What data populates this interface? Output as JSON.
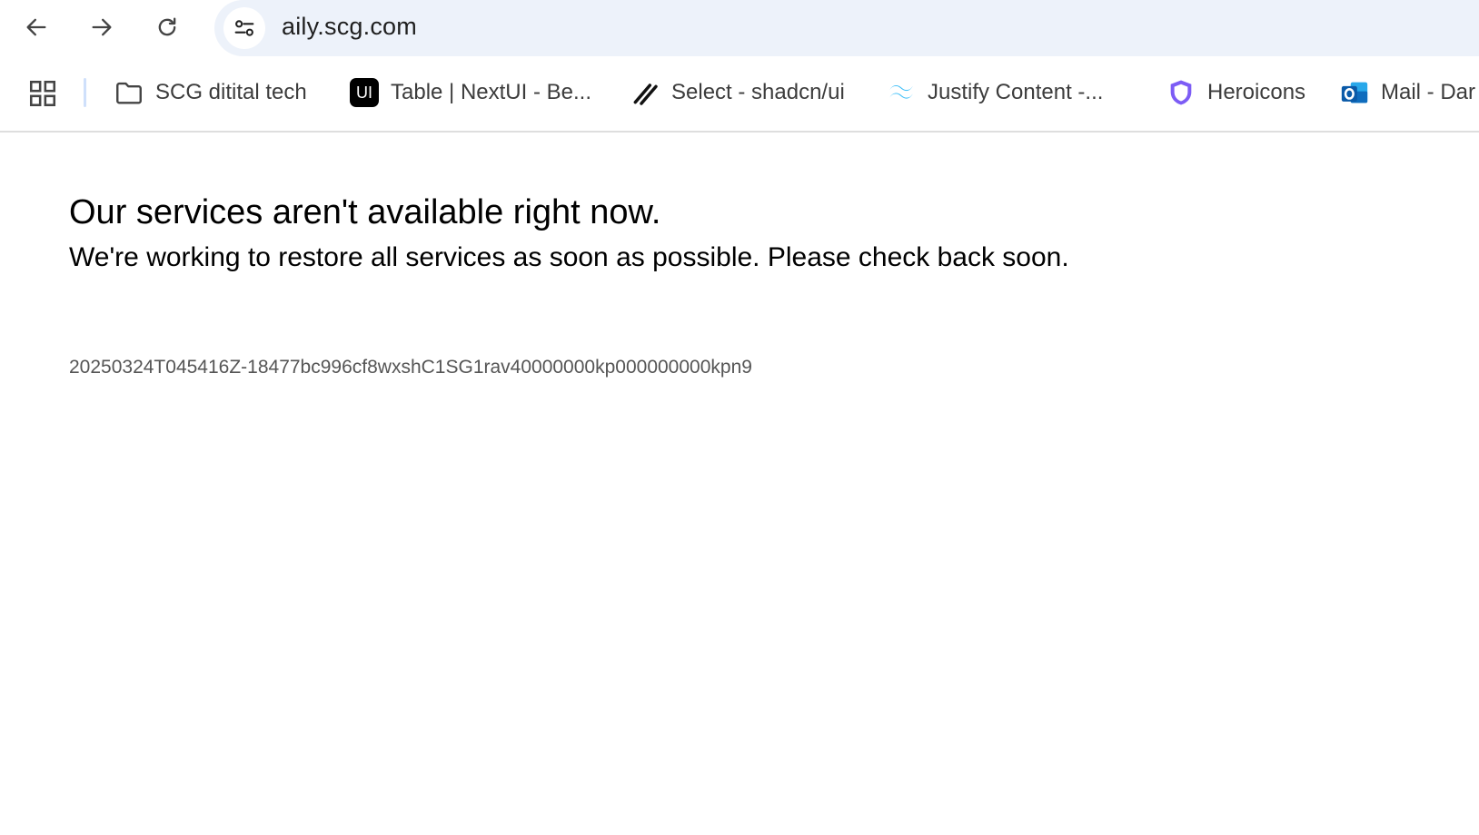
{
  "browser": {
    "url": "aily.scg.com",
    "bookmarks": [
      {
        "label": "SCG ditital tech",
        "icon": "folder-icon"
      },
      {
        "label": "Table | NextUI - Be...",
        "icon": "nextui-icon",
        "badge": "UI"
      },
      {
        "label": "Select - shadcn/ui",
        "icon": "shadcn-icon"
      },
      {
        "label": "Justify Content -...",
        "icon": "tailwind-icon"
      },
      {
        "label": "Heroicons",
        "icon": "heroicons-shield-icon"
      },
      {
        "label": "Mail - Dar",
        "icon": "outlook-icon"
      }
    ]
  },
  "page": {
    "heading": "Our services aren't available right now.",
    "subheading": "We're working to restore all services as soon as possible. Please check back soon.",
    "reference_id": "20250324T045416Z-18477bc996cf8wxshC1SG1rav40000000kp000000000kpn9"
  },
  "colors": {
    "omnibox_bg": "#edf2fa",
    "tailwind": "#38bdf8",
    "heroicons": "#7c5cf5",
    "outlook": "#0f6cbd"
  }
}
